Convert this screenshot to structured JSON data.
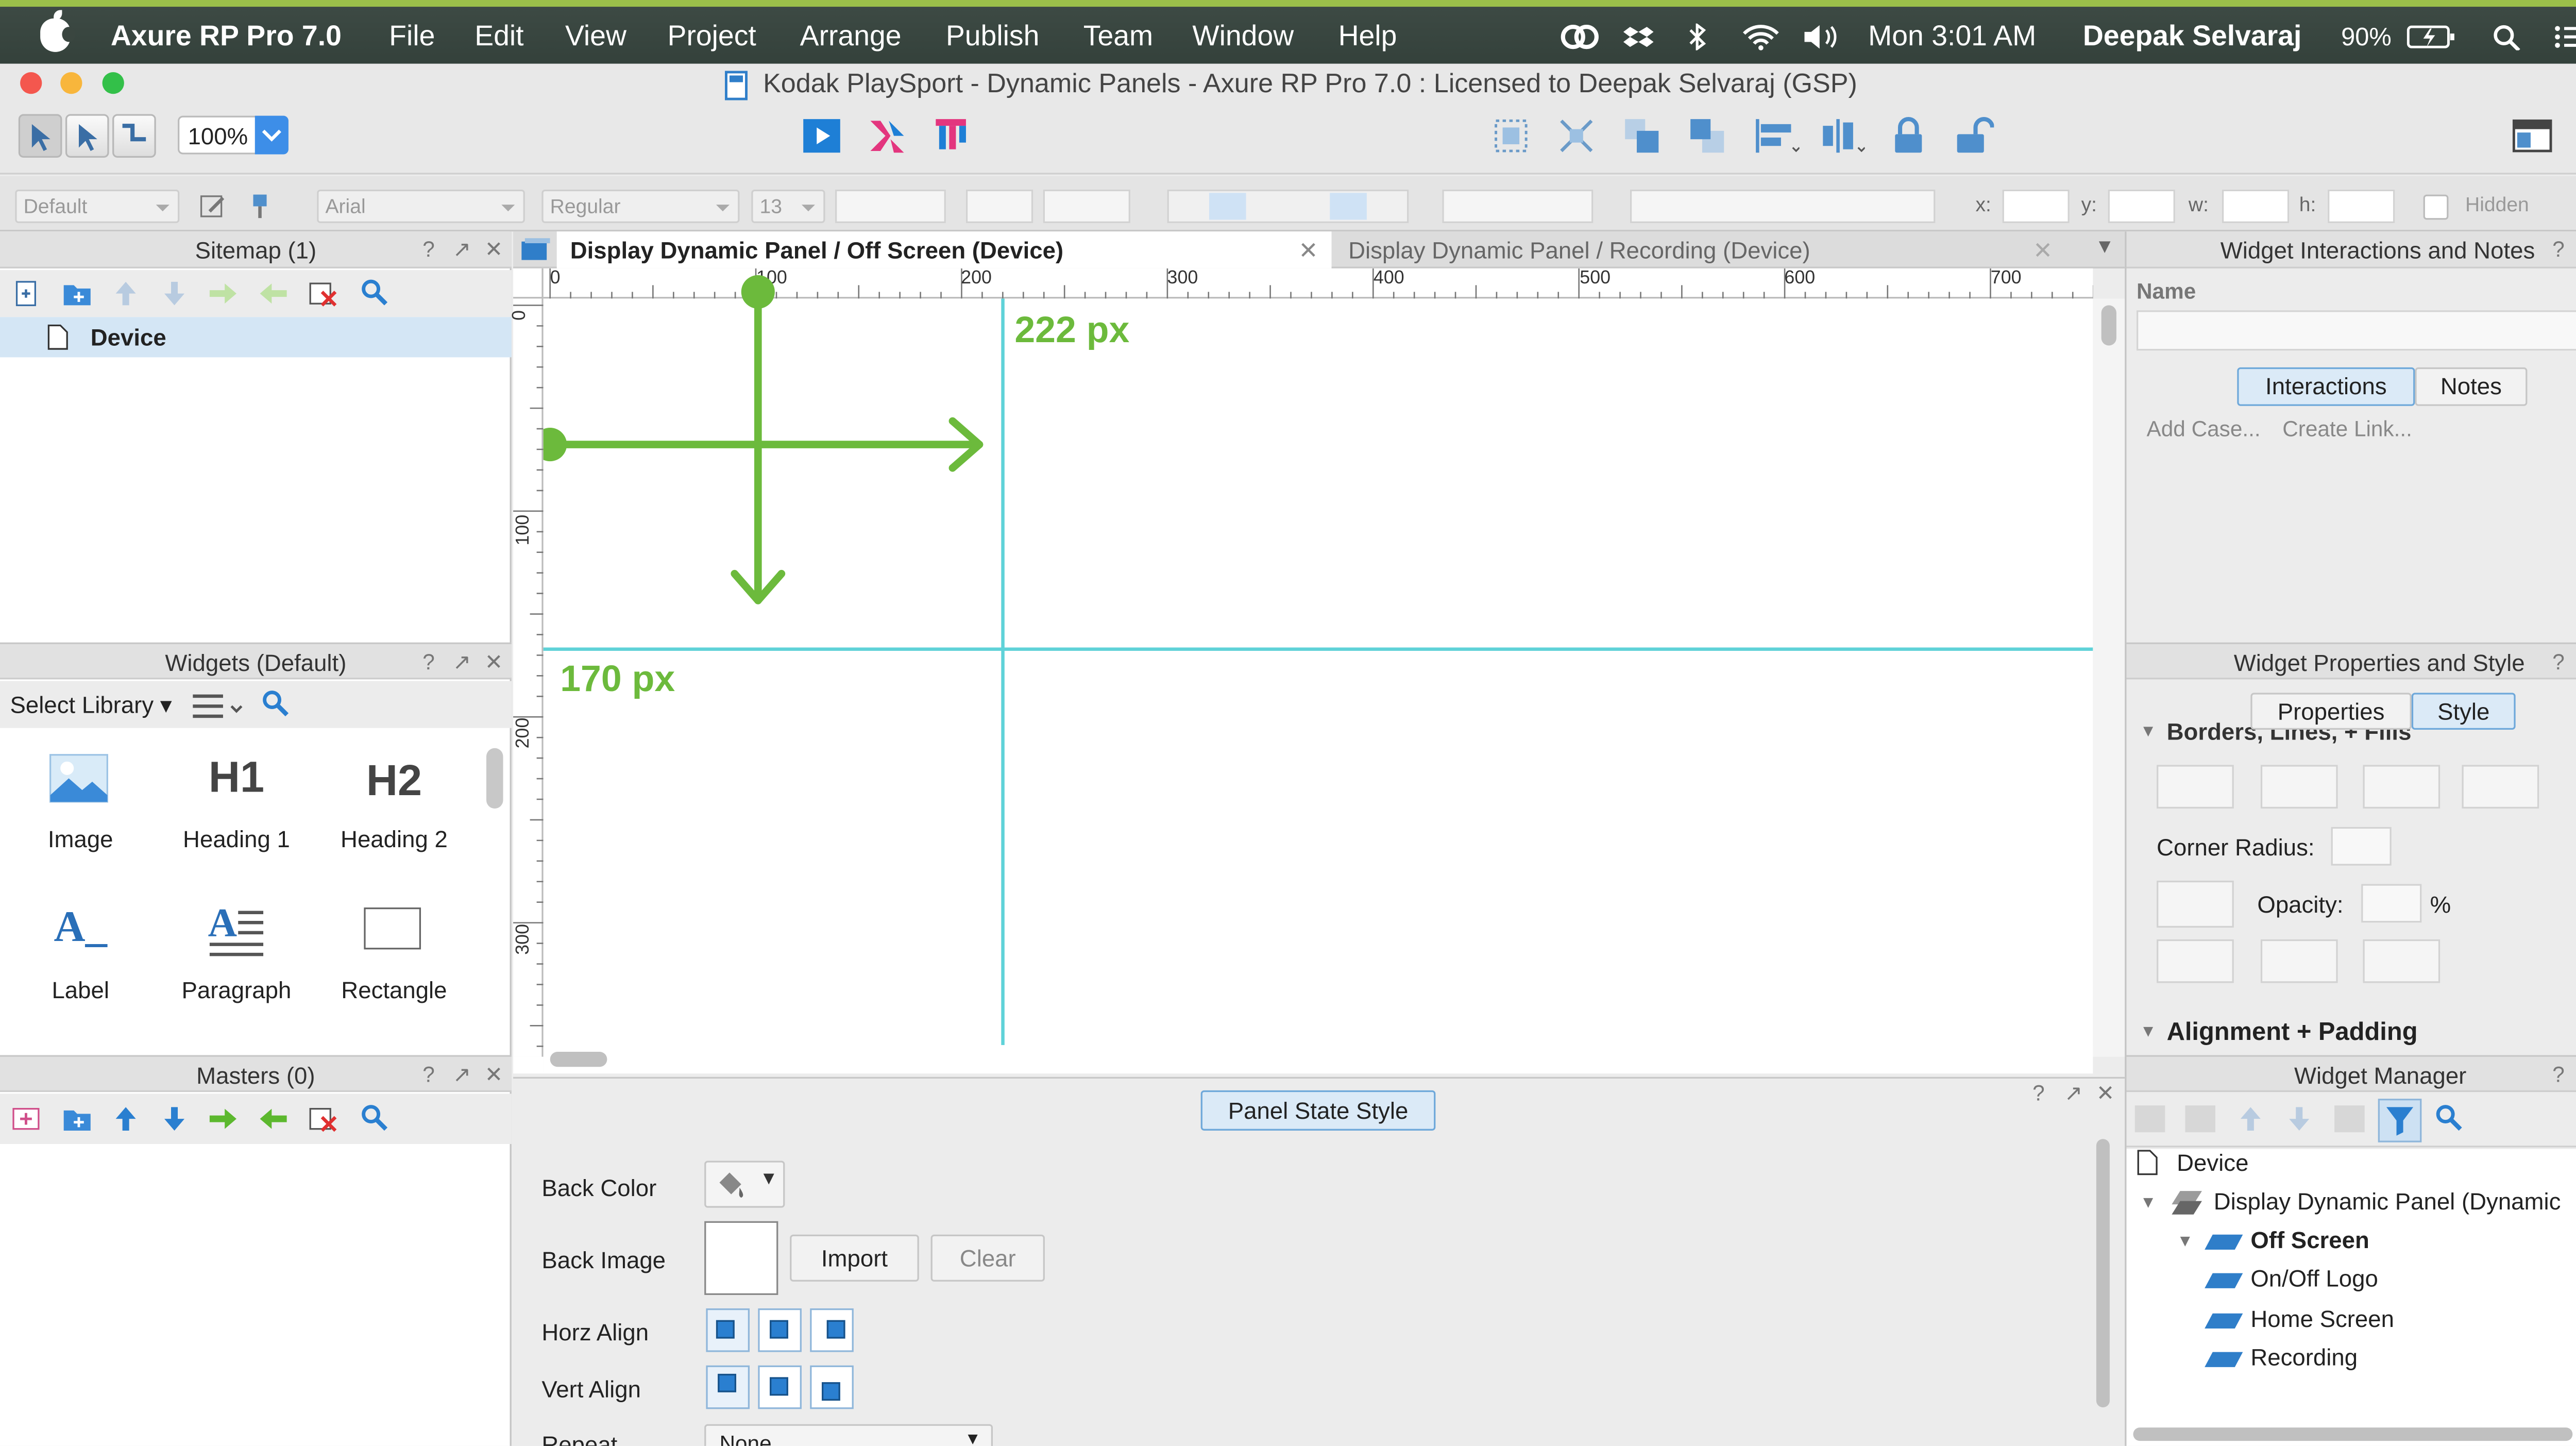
{
  "menubar": {
    "app_name": "Axure RP Pro 7.0",
    "items": [
      "File",
      "Edit",
      "View",
      "Project",
      "Arrange",
      "Publish",
      "Team",
      "Window",
      "Help"
    ],
    "clock": "Mon 3:01 AM",
    "user": "Deepak Selvaraj",
    "battery": "90%"
  },
  "window": {
    "title": "Kodak PlaySport - Dynamic Panels - Axure RP Pro 7.0 : Licensed to Deepak Selvaraj (GSP)"
  },
  "toolbar": {
    "zoom": "100%"
  },
  "format_bar": {
    "style": "Default",
    "font": "Arial",
    "weight": "Regular",
    "size": "13",
    "x_label": "x:",
    "y_label": "y:",
    "w_label": "w:",
    "h_label": "h:",
    "hidden_label": "Hidden"
  },
  "sitemap": {
    "title": "Sitemap (1)",
    "pages": [
      "Device"
    ]
  },
  "widgets": {
    "title": "Widgets (Default)",
    "select_library": "Select Library",
    "items": [
      {
        "label": "Image",
        "icon": "image-icon"
      },
      {
        "label": "Heading 1",
        "icon": "h1-icon",
        "glyph": "H1"
      },
      {
        "label": "Heading 2",
        "icon": "h2-icon",
        "glyph": "H2"
      },
      {
        "label": "Label",
        "icon": "label-icon",
        "glyph": "A_"
      },
      {
        "label": "Paragraph",
        "icon": "paragraph-icon",
        "glyph": "A"
      },
      {
        "label": "Rectangle",
        "icon": "rectangle-icon"
      }
    ]
  },
  "masters": {
    "title": "Masters (0)"
  },
  "tabs": [
    "Display Dynamic Panel / Off Screen (Device)",
    "Display Dynamic Panel / Recording (Device)"
  ],
  "ruler": {
    "h_ticks": [
      "0",
      "100",
      "200",
      "300",
      "400",
      "500",
      "600",
      "700"
    ],
    "v_ticks": [
      "0",
      "100",
      "200",
      "300"
    ]
  },
  "annotations": {
    "width_label": "222 px",
    "height_label": "170 px",
    "color": "#6cba3c"
  },
  "guides": {
    "color": "#5fd2d8"
  },
  "panel_state_style": {
    "title": "Panel State Style",
    "back_color": "Back Color",
    "back_image": "Back Image",
    "import": "Import",
    "clear": "Clear",
    "horz_align": "Horz Align",
    "vert_align": "Vert Align",
    "repeat": "Repeat",
    "repeat_value": "None"
  },
  "interactions": {
    "title": "Widget Interactions and Notes",
    "name_label": "Name",
    "tab_interactions": "Interactions",
    "tab_notes": "Notes",
    "add_case": "Add Case...",
    "create_link": "Create Link..."
  },
  "properties": {
    "title": "Widget Properties and Style",
    "tab_properties": "Properties",
    "tab_style": "Style",
    "section_borders": "Borders, Lines, + Fills",
    "corner_radius": "Corner Radius:",
    "opacity": "Opacity:",
    "percent": "%",
    "section_alignment": "Alignment + Padding"
  },
  "widget_manager": {
    "title": "Widget Manager",
    "tree": {
      "page": "Device",
      "panel": "Display Dynamic Panel (Dynamic",
      "states": [
        "Off Screen",
        "On/Off Logo",
        "Home Screen",
        "Recording"
      ]
    }
  },
  "colors": {
    "accent": "#2a7fd0",
    "selected_row": "#d4e6f5",
    "menubar": "#38443e"
  }
}
